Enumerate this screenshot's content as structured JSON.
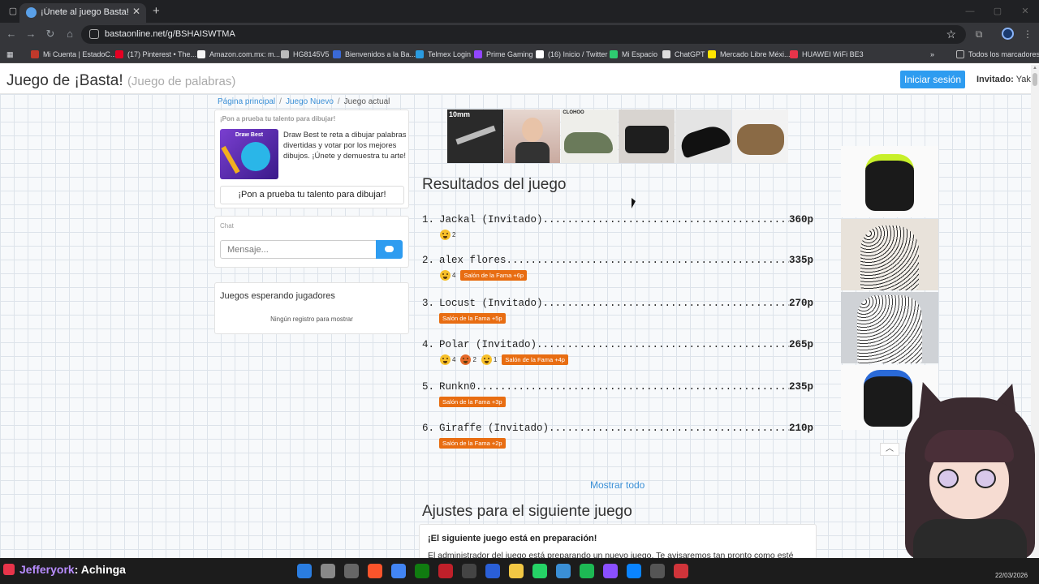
{
  "browser": {
    "tab_title": "¡Únete al juego Basta!",
    "url": "bastaonline.net/g/BSHAISWTMA",
    "bookmarks": [
      {
        "label": "Mi Cuenta | EstadoC...",
        "color": "#c0392b"
      },
      {
        "label": "(17) Pinterest • The...",
        "color": "#e60023"
      },
      {
        "label": "Amazon.com.mx: m...",
        "color": "#f5f5f5"
      },
      {
        "label": "HG8145V5",
        "color": "#bbbbbb"
      },
      {
        "label": "Bienvenidos a la Ba...",
        "color": "#3a6ad8"
      },
      {
        "label": "Telmex Login",
        "color": "#2a9be0"
      },
      {
        "label": "Prime Gaming",
        "color": "#9146ff"
      },
      {
        "label": "(16) Inicio / Twitter",
        "color": "#ffffff"
      },
      {
        "label": "Mi Espacio",
        "color": "#2ecc71"
      },
      {
        "label": "ChatGPT",
        "color": "#dddddd"
      },
      {
        "label": "Mercado Libre Méxi...",
        "color": "#ffe600"
      },
      {
        "label": "HUAWEI WiFi BE3",
        "color": "#e8344a"
      }
    ],
    "all_bookmarks": "Todos los marcadores"
  },
  "header": {
    "title": "Juego de ¡Basta!",
    "subtitle": "(Juego de palabras)",
    "login_button": "Iniciar sesión",
    "guest_label": "Invitado:",
    "guest_name": "Yak"
  },
  "breadcrumb": {
    "home": "Página principal",
    "new_game": "Juego Nuevo",
    "current": "Juego actual"
  },
  "promo": {
    "heading": "¡Pon a prueba tu talento para dibujar!",
    "image_title": "Draw Best",
    "text": "Draw Best te reta a dibujar palabras divertidas y votar por los mejores dibujos. ¡Únete y demuestra tu arte!",
    "button": "¡Pon a prueba tu talento para dibujar!"
  },
  "chat": {
    "label": "Chat",
    "placeholder": "Mensaje..."
  },
  "waiting": {
    "title": "Juegos esperando jugadores",
    "empty": "Ningún registro para mostrar"
  },
  "ads": {
    "wrench_label": "10mm",
    "shoe_label": "CLOHOO"
  },
  "results": {
    "title": "Resultados del juego",
    "items": [
      {
        "rank": "1.",
        "name": "Jackal (Invitado)",
        "points": "360p",
        "reactions": [
          {
            "type": "wow",
            "count": "2"
          }
        ],
        "fame": ""
      },
      {
        "rank": "2.",
        "name": "alex flores",
        "points": "335p",
        "reactions": [
          {
            "type": "laugh",
            "count": "4"
          }
        ],
        "fame": "Salón de la Fama +6p"
      },
      {
        "rank": "3.",
        "name": "Locust (Invitado)",
        "points": "270p",
        "reactions": [],
        "fame": "Salón de la Fama +5p"
      },
      {
        "rank": "4.",
        "name": "Polar (Invitado)",
        "points": "265p",
        "reactions": [
          {
            "type": "wow",
            "count": "4"
          },
          {
            "type": "angry",
            "count": "2"
          },
          {
            "type": "laugh",
            "count": "1"
          }
        ],
        "fame": "Salón de la Fama +4p"
      },
      {
        "rank": "5.",
        "name": "Runkn0",
        "points": "235p",
        "reactions": [],
        "fame": "Salón de la Fama +3p"
      },
      {
        "rank": "6.",
        "name": "Giraffe (Invitado)",
        "points": "210p",
        "reactions": [],
        "fame": "Salón de la Fama +2p"
      }
    ],
    "show_all": "Mostrar todo"
  },
  "next_game": {
    "title": "Ajustes para el siguiente juego",
    "heading": "¡El siguiente juego está en preparación!",
    "text": "El administrador del juego está preparando un nuevo juego. Te avisaremos tan pronto como esté"
  },
  "taskbar": {
    "user": "Jefferyork",
    "message": ": Achinga",
    "date": "22/03/2026",
    "app_colors": [
      "#2a7de1",
      "#888888",
      "#666666",
      "#fb542b",
      "#4285f4",
      "#107c10",
      "#c0202a",
      "#444444",
      "#2a5fd8",
      "#f2c744",
      "#25d366",
      "#3a8fd6",
      "#1db954",
      "#8a4fff",
      "#0a84ff",
      "#555555",
      "#d0343a"
    ]
  }
}
